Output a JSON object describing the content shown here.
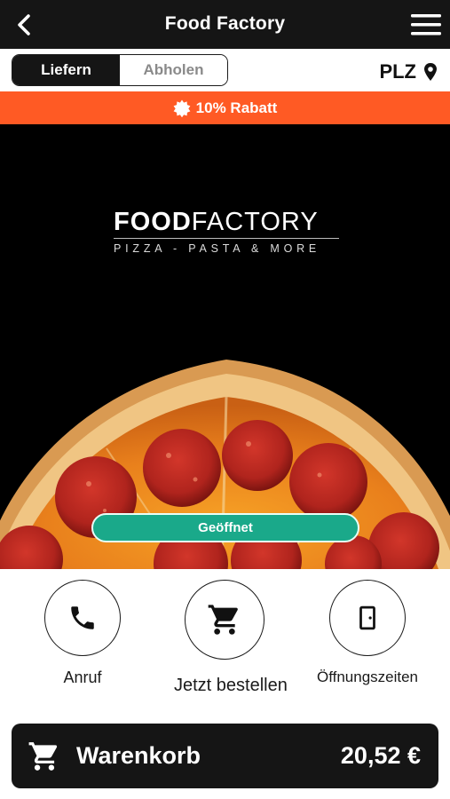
{
  "header": {
    "title": "Food Factory",
    "back_icon": "chevron-left-icon",
    "menu_icon": "hamburger-menu-icon"
  },
  "mode": {
    "options": [
      "Liefern",
      "Abholen"
    ],
    "selected": "Liefern"
  },
  "postcode": {
    "label": "PLZ",
    "icon": "location-pin-icon"
  },
  "discount": {
    "label": "10% Rabatt",
    "icon": "badge-icon"
  },
  "hero": {
    "logo_bold": "FOOD",
    "logo_light": "FACTORY",
    "logo_subtitle": "PIZZA - PASTA & MORE",
    "status_label": "Geöffnet"
  },
  "actions": [
    {
      "label": "Anruf",
      "icon": "phone-icon"
    },
    {
      "label": "Jetzt bestellen",
      "icon": "cart-icon"
    },
    {
      "label": "Öffnungszeiten",
      "icon": "door-icon"
    }
  ],
  "cart": {
    "label": "Warenkorb",
    "total": "20,52 €",
    "icon": "cart-icon"
  },
  "colors": {
    "dark": "#151515",
    "accent_orange": "#ff5a24",
    "open_green": "#1aa98a"
  }
}
